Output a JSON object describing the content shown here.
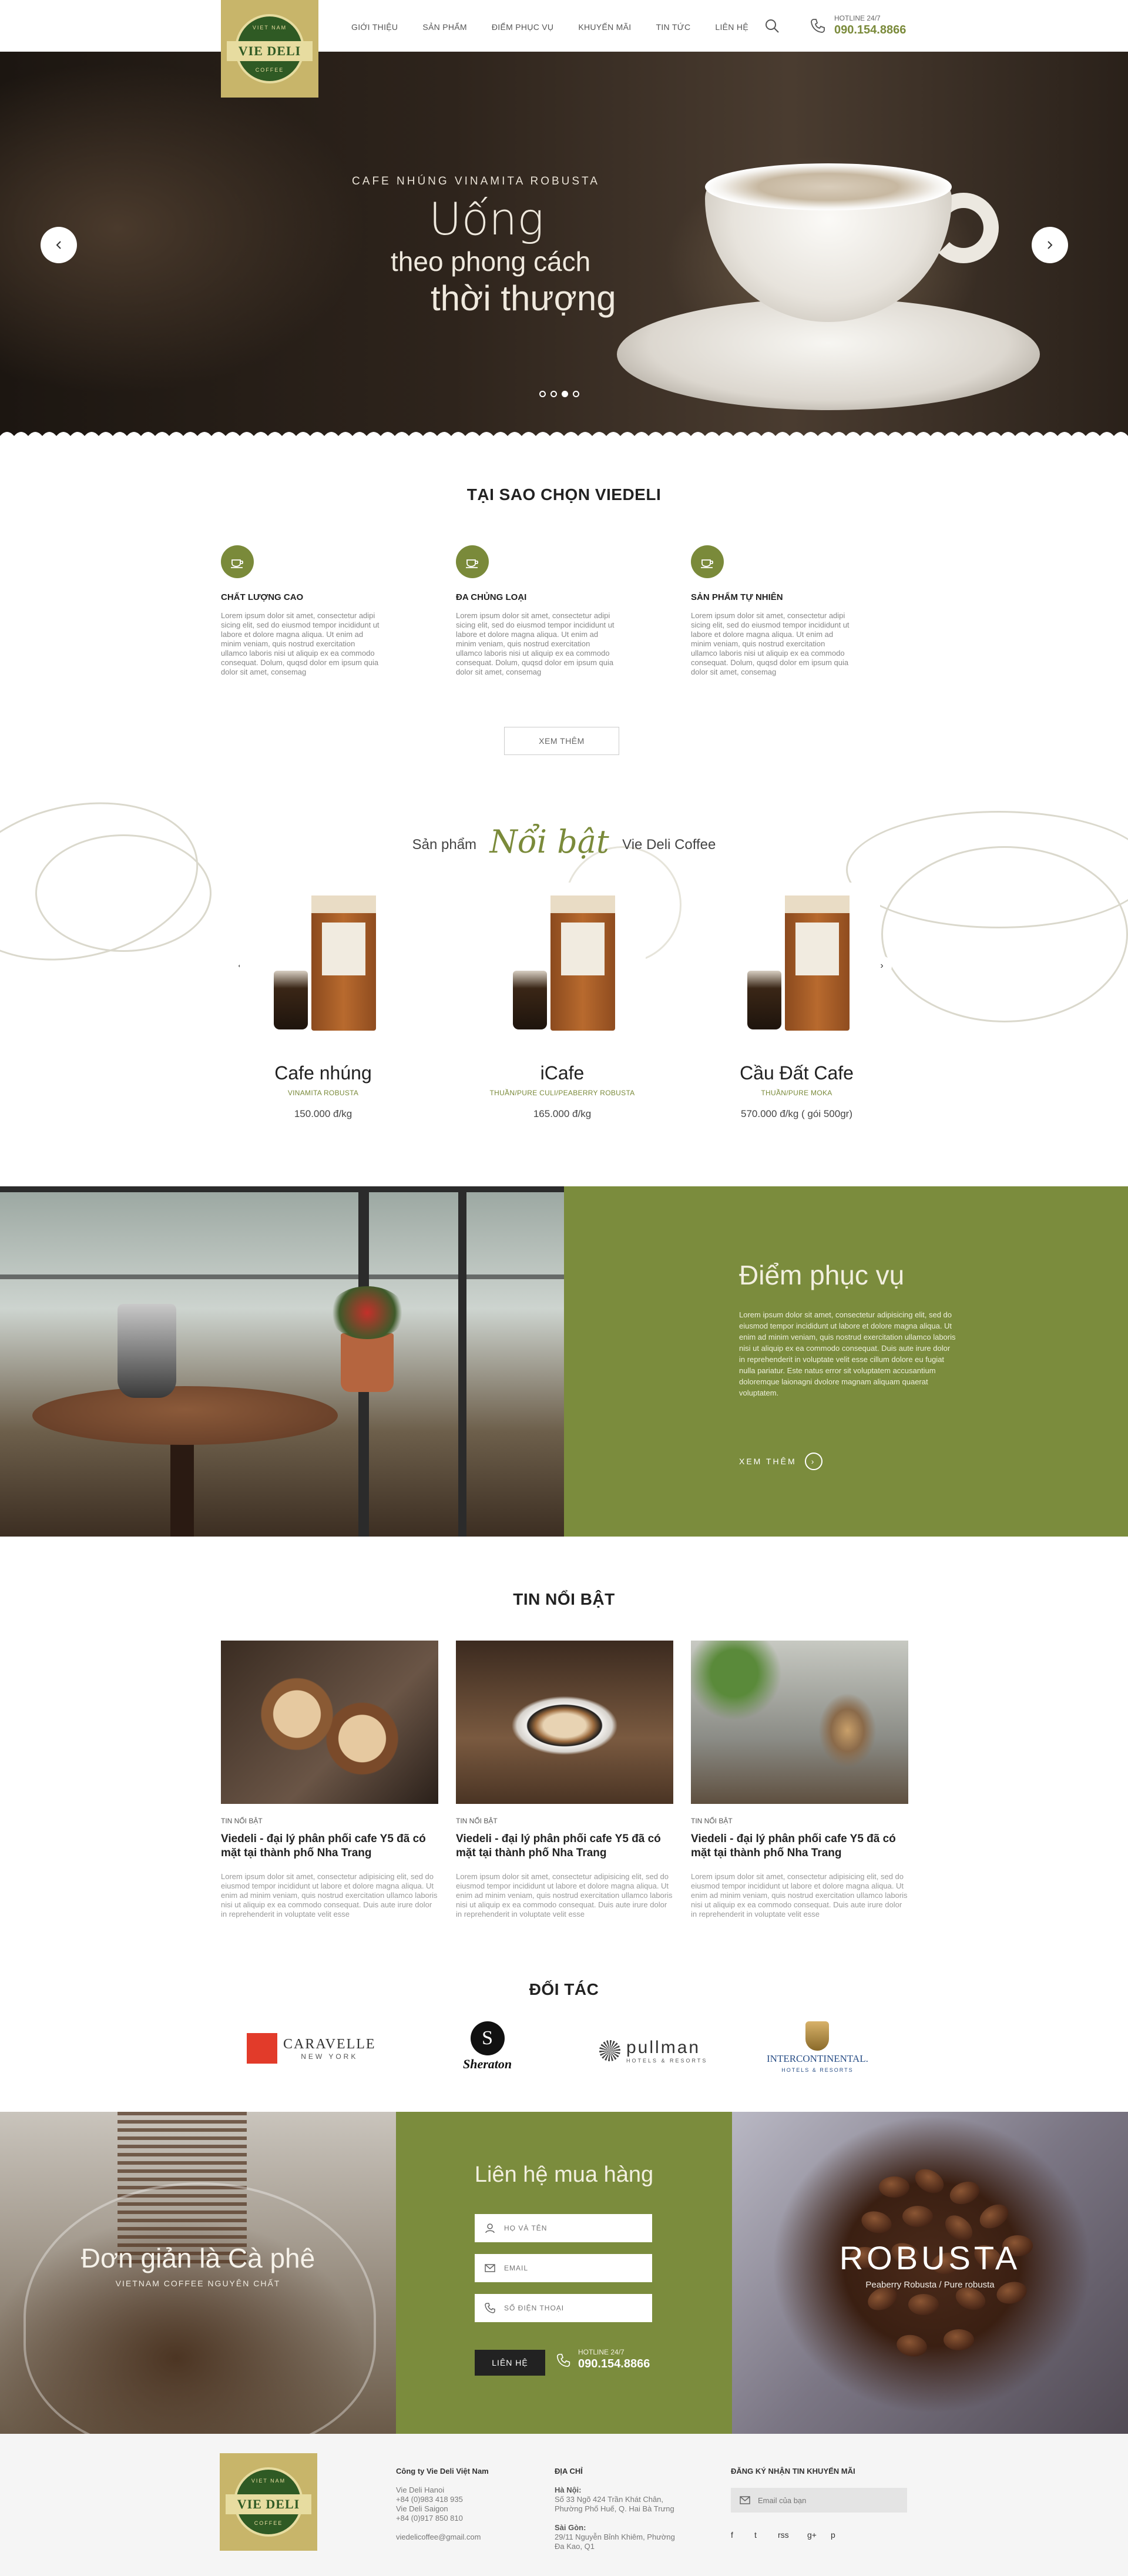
{
  "header": {
    "nav": [
      "GIỚI THIỆU",
      "SẢN PHẨM",
      "ĐIỂM PHỤC VỤ",
      "KHUYẾN MÃI",
      "TIN TỨC",
      "LIÊN HỆ"
    ],
    "hotline_label": "HOTLINE 24/7",
    "hotline_number": "090.154.8866",
    "logo": {
      "top": "VIET NAM",
      "main": "VIE DELI",
      "bottom": "COFFEE"
    }
  },
  "hero": {
    "subtitle": "CAFE NHÚNG VINAMITA ROBUSTA",
    "line1": "Uống",
    "line2": "theo phong cách",
    "line3": "thời thượng",
    "slides": 4,
    "active_slide": 3
  },
  "why": {
    "title": "TẠI SAO CHỌN VIEDELI",
    "features": [
      {
        "title": "CHẤT LƯỢNG CAO",
        "text": "Lorem ipsum dolor sit amet, consectetur adipi sicing elit, sed do eiusmod tempor incididunt ut labore et dolore magna aliqua. Ut enim ad minim veniam, quis nostrud exercitation ullamco laboris nisi ut aliquip ex ea commodo consequat. Dolum, quqsd dolor em ipsum quia dolor sit amet, consemag"
      },
      {
        "title": "ĐA CHỦNG LOẠI",
        "text": "Lorem ipsum dolor sit amet, consectetur adipi sicing elit, sed do eiusmod tempor incididunt ut labore et dolore magna aliqua. Ut enim ad minim veniam, quis nostrud exercitation ullamco laboris nisi ut aliquip ex ea commodo consequat. Dolum, quqsd dolor em ipsum quia dolor sit amet, consemag"
      },
      {
        "title": "SẢN PHẨM TỰ NHIÊN",
        "text": "Lorem ipsum dolor sit amet, consectetur adipi sicing elit, sed do eiusmod tempor incididunt ut labore et dolore magna aliqua. Ut enim ad minim veniam, quis nostrud exercitation ullamco laboris nisi ut aliquip ex ea commodo consequat. Dolum, quqsd dolor em ipsum quia dolor sit amet, consemag"
      }
    ],
    "more_button": "XEM THÊM"
  },
  "products": {
    "heading_a": "Sản phẩm",
    "heading_b": "Nổi bật",
    "heading_c": "Vie Deli Coffee",
    "items": [
      {
        "name": "Cafe nhúng",
        "sub": "VINAMITA ROBUSTA",
        "price": "150.000 đ/kg"
      },
      {
        "name": "iCafe",
        "sub": "THUẦN/PURE CULI/PEABERRY ROBUSTA",
        "price": "165.000 đ/kg"
      },
      {
        "name": "Cầu Đất Cafe",
        "sub": "THUẦN/PURE MOKA",
        "price": "570.000 đ/kg ( gói 500gr)"
      }
    ]
  },
  "service": {
    "title": "Điểm phục vụ",
    "text": "Lorem ipsum dolor sit amet, consectetur adipisicing elit, sed do eiusmod tempor incididunt ut labore et dolore magna aliqua. Ut enim ad minim veniam, quis nostrud exercitation ullamco laboris nisi ut aliquip ex ea commodo consequat. Duis aute irure dolor in reprehenderit in voluptate velit esse cillum dolore eu fugiat nulla pariatur. Este natus error sit voluptatem accusantium doloremque laionagni dvolore magnam aliquam quaerat voluptatem.",
    "more": "XEM THÊM"
  },
  "news": {
    "title": "TIN NỔI BẬT",
    "items": [
      {
        "tag": "TIN NỔI BẬT",
        "title": "Viedeli - đại lý phân phối cafe Y5 đã có mặt tại thành phố Nha Trang",
        "text": "Lorem ipsum dolor sit amet, consectetur adipisicing elit, sed do eiusmod tempor incididunt ut labore et dolore magna aliqua. Ut enim ad minim veniam, quis nostrud exercitation ullamco laboris nisi ut aliquip ex ea commodo consequat. Duis aute irure dolor in reprehenderit in voluptate velit esse"
      },
      {
        "tag": "TIN NỔI BẬT",
        "title": "Viedeli - đại lý phân phối cafe Y5 đã có mặt tại thành phố Nha Trang",
        "text": "Lorem ipsum dolor sit amet, consectetur adipisicing elit, sed do eiusmod tempor incididunt ut labore et dolore magna aliqua. Ut enim ad minim veniam, quis nostrud exercitation ullamco laboris nisi ut aliquip ex ea commodo consequat. Duis aute irure dolor in reprehenderit in voluptate velit esse"
      },
      {
        "tag": "TIN NỔI BẬT",
        "title": "Viedeli - đại lý phân phối cafe Y5 đã có mặt tại thành phố Nha Trang",
        "text": "Lorem ipsum dolor sit amet, consectetur adipisicing elit, sed do eiusmod tempor incididunt ut labore et dolore magna aliqua. Ut enim ad minim veniam, quis nostrud exercitation ullamco laboris nisi ut aliquip ex ea commodo consequat. Duis aute irure dolor in reprehenderit in voluptate velit esse"
      }
    ]
  },
  "partners": {
    "title": "ĐỐI TÁC",
    "items": [
      {
        "name": "CARAVELLE",
        "sub": "NEW YORK"
      },
      {
        "name": "Sheraton",
        "sub": ""
      },
      {
        "name": "pullman",
        "sub": "HOTELS & RESORTS"
      },
      {
        "name": "INTERCONTINENTAL.",
        "sub": "HOTELS & RESORTS"
      }
    ]
  },
  "contact": {
    "left_title": "Đơn giản là Cà phê",
    "left_sub": "VIETNAM COFFEE NGUYÊN CHẤT",
    "title": "Liên hệ mua hàng",
    "name_placeholder": "HỌ VÀ TÊN",
    "email_placeholder": "EMAIL",
    "phone_placeholder": "SỐ ĐIỆN THOẠI",
    "send": "LIÊN HỆ",
    "hotline_label": "HOTLINE 24/7",
    "hotline_number": "090.154.8866",
    "right_title": "ROBUSTA",
    "right_sub": "Peaberry Robusta / Pure robusta"
  },
  "footer": {
    "company": "Công ty Vie Deli Việt Nam",
    "lines": [
      "Vie Deli Hanoi",
      "+84 (0)983 418 935",
      "Vie Deli Saigon",
      "+84 (0)917 850 810",
      "viedelicoffee@gmail.com"
    ],
    "address_title": "ĐỊA CHỈ",
    "hanoi": "Hà Nội:",
    "hanoi_lines": [
      "Số 33 Ngõ 424 Trần Khát Chân,",
      "Phường Phố Huế, Q. Hai Bà Trưng"
    ],
    "saigon": "Sài Gòn:",
    "saigon_lines": [
      "29/11 Nguyễn Bỉnh Khiêm, Phường",
      "Đa Kao, Q1"
    ],
    "newsletter_title": "ĐĂNG KÝ NHẬN TIN KHUYẾN MÃI",
    "newsletter_placeholder": "Email của bạn",
    "social": [
      "f",
      "t",
      "rss",
      "g+",
      "p"
    ]
  },
  "colors": {
    "olive": "#7b8c3d",
    "gold": "#c8b56a",
    "dark_green": "#2f5a24"
  }
}
